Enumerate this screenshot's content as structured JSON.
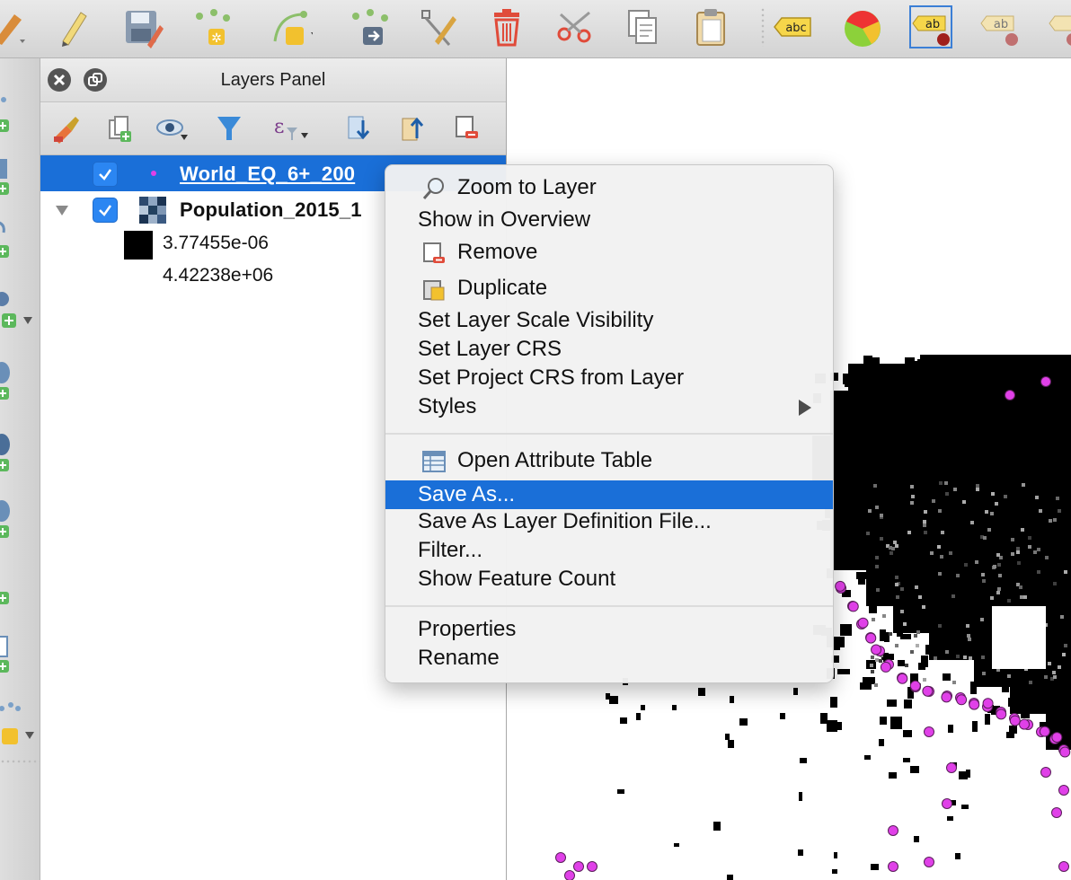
{
  "panel": {
    "title": "Layers Panel"
  },
  "layers": [
    {
      "name": "World_EQ_6+_200",
      "checked": true,
      "selected": true
    },
    {
      "name": "Population_2015_1",
      "checked": true,
      "selected": false,
      "legend_min": "3.77455e-06",
      "legend_max": "4.42238e+06"
    }
  ],
  "context_menu": {
    "items": [
      {
        "label": "Zoom to Layer",
        "icon": "zoom-icon"
      },
      {
        "label": "Show in Overview"
      },
      {
        "label": "Remove",
        "icon": "remove-layer-icon"
      },
      {
        "label": "Duplicate",
        "icon": "duplicate-layer-icon"
      },
      {
        "label": "Set Layer Scale Visibility"
      },
      {
        "label": "Set Layer CRS"
      },
      {
        "label": "Set Project CRS from Layer"
      },
      {
        "label": "Styles",
        "submenu": true
      },
      {
        "label": "Open Attribute Table",
        "icon": "table-icon"
      },
      {
        "label": "Save As...",
        "highlighted": true
      },
      {
        "label": "Save As Layer Definition File..."
      },
      {
        "label": "Filter..."
      },
      {
        "label": "Show Feature Count"
      },
      {
        "label": "Properties"
      },
      {
        "label": "Rename"
      }
    ]
  },
  "toolbar": {
    "label_tool_text": "abc",
    "label_tool_text2": "ab"
  },
  "colors": {
    "selection": "#1a6fd8",
    "earthquake_point": "#e040e8",
    "population_raster": "#000000"
  }
}
